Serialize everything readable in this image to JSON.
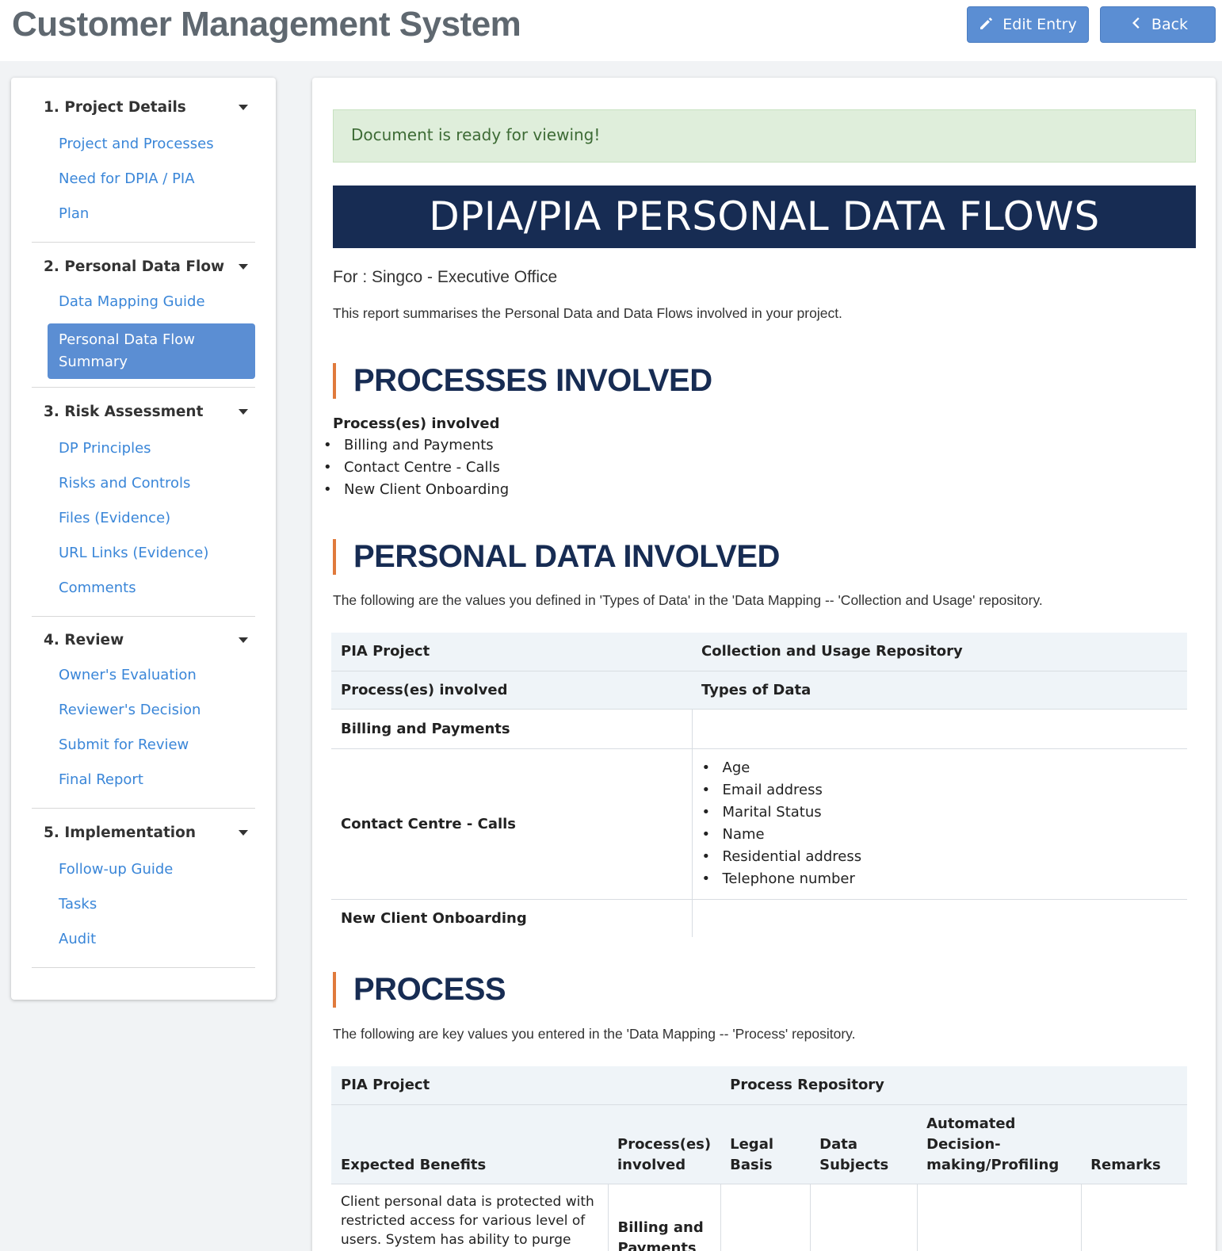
{
  "header": {
    "title": "Customer Management System",
    "edit_label": "Edit Entry",
    "back_label": "Back"
  },
  "sidebar": {
    "sections": [
      {
        "title": "1. Project Details",
        "items": [
          "Project and Processes",
          "Need for DPIA / PIA",
          "Plan"
        ]
      },
      {
        "title": "2. Personal Data Flow",
        "items": [
          "Data Mapping Guide",
          "Personal Data Flow Summary"
        ]
      },
      {
        "title": "3. Risk Assessment",
        "items": [
          "DP Principles",
          "Risks and Controls",
          "Files (Evidence)",
          "URL Links (Evidence)",
          "Comments"
        ]
      },
      {
        "title": "4. Review",
        "items": [
          "Owner's Evaluation",
          "Reviewer's Decision",
          "Submit for Review",
          "Final Report"
        ]
      },
      {
        "title": "5. Implementation",
        "items": [
          "Follow-up Guide",
          "Tasks",
          "Audit"
        ]
      }
    ],
    "active_item": "Personal Data Flow Summary"
  },
  "main": {
    "alert": "Document is ready for viewing!",
    "banner": "DPIA/PIA PERSONAL DATA FLOWS",
    "for_line": "For : Singco - Executive Office",
    "intro": "This report summarises the Personal Data and Data Flows involved in your project.",
    "processes": {
      "heading": "PROCESSES INVOLVED",
      "label": "Process(es) involved",
      "items": [
        "Billing and Payments",
        "Contact Centre - Calls",
        "New Client Onboarding"
      ]
    },
    "personal_data": {
      "heading": "PERSONAL DATA INVOLVED",
      "description": "The following are the values you defined in 'Types of Data' in the 'Data Mapping -- 'Collection and Usage' repository.",
      "table": {
        "h1_left": "PIA Project",
        "h1_right": "Collection and Usage Repository",
        "h2_left": "Process(es) involved",
        "h2_right": "Types of Data",
        "rows": [
          {
            "process": "Billing and Payments",
            "types": []
          },
          {
            "process": "Contact Centre - Calls",
            "types": [
              "Age",
              "Email address",
              "Marital Status",
              "Name",
              "Residential address",
              "Telephone number"
            ]
          },
          {
            "process": "New Client Onboarding",
            "types": []
          }
        ]
      }
    },
    "process": {
      "heading": "PROCESS",
      "description": "The following are key values you entered in the 'Data Mapping -- 'Process' repository.",
      "table": {
        "h1_left": "PIA Project",
        "h1_right": "Process Repository",
        "columns": [
          "Expected Benefits",
          "Process(es) involved",
          "Legal Basis",
          "Data Subjects",
          "Automated Decision-making/Profiling",
          "Remarks"
        ],
        "row": {
          "benefit": "Client personal data is protected with restricted access for various level of users. System has ability to purge",
          "process": "Billing and Payments"
        }
      }
    }
  }
}
